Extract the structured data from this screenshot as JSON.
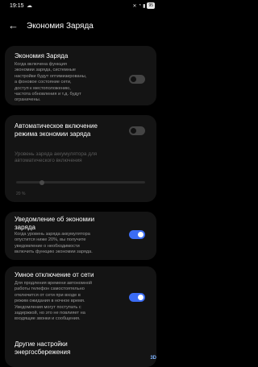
{
  "status_bar": {
    "time": "19:15",
    "battery": "95"
  },
  "header": {
    "title": "Экономия Заряда"
  },
  "items": [
    {
      "title": "Экономия Заряда",
      "desc": [
        "Когда включена функция",
        "экономии заряда, системные",
        "настройки будут оптимизированы,",
        "а фоновое состояние сети,",
        "доступ к местоположению,",
        "частота обновления и т.д. будут",
        "ограничены."
      ],
      "toggle": "off"
    },
    {
      "title": [
        "Автоматическое включение",
        "режима экономии заряда"
      ],
      "toggle": "off",
      "sub": [
        "Уровень заряда аккумулятора для",
        "автоматического включения"
      ],
      "slider_value": "20 %",
      "slider_level": 0.2
    },
    {
      "title": [
        "Уведомление об экономии",
        "заряда"
      ],
      "desc": [
        "Когда уровень заряда аккумулятора",
        "опустится ниже 20%, вы получите",
        "уведомление о необходимости",
        "включить функцию экономии заряда."
      ],
      "toggle": "on"
    },
    {
      "title": [
        "Умное отключение от сети"
      ],
      "desc": [
        "Для продления времени автономной",
        "работы телефон самостоятельно",
        "отключится от сети при входе в",
        "режим ожидания в ночное время.",
        "Уведомления могут поступать с",
        "задержкой, но это не повлияет на",
        "входящие звонки и сообщения."
      ],
      "toggle": "on"
    },
    {
      "title": [
        "Другие настройки",
        "энергосбережения"
      ]
    }
  ]
}
